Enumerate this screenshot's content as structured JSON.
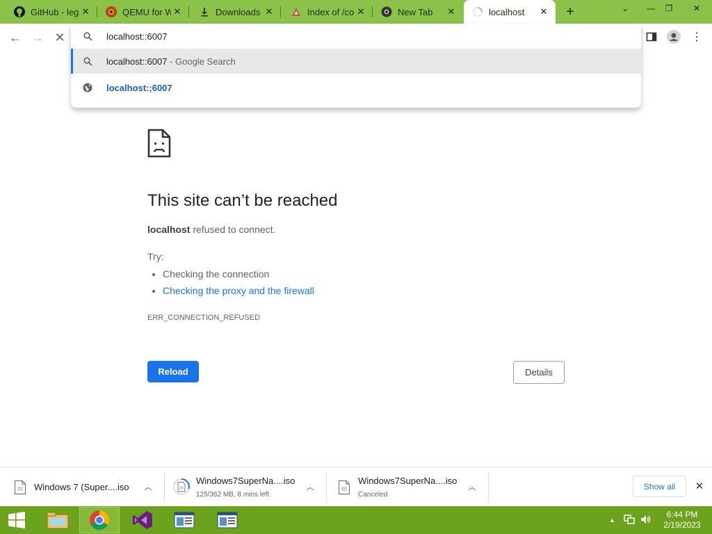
{
  "tabs": [
    {
      "title": "GitHub - leg",
      "icon": "github-icon"
    },
    {
      "title": "QEMU for W",
      "icon": "qemu-icon"
    },
    {
      "title": "Downloads",
      "icon": "download-icon"
    },
    {
      "title": "Index of /co",
      "icon": "index-icon"
    },
    {
      "title": "New Tab",
      "icon": "chrome-icon"
    },
    {
      "title": "localhost",
      "icon": "loading-spinner-icon",
      "active": true
    }
  ],
  "omnibox": {
    "value": "localhost::6007",
    "suggestions": [
      {
        "primary": "localhost::6007",
        "secondary": " - Google Search",
        "icon": "search-icon"
      },
      {
        "primary": "localhost:;6007",
        "secondary": "",
        "icon": "globe-icon"
      }
    ]
  },
  "error": {
    "title": "This site can’t be reached",
    "host": "localhost",
    "message": " refused to connect.",
    "try_label": "Try:",
    "suggestions": [
      "Checking the connection",
      "Checking the proxy and the firewall"
    ],
    "code": "ERR_CONNECTION_REFUSED",
    "reload_label": "Reload",
    "details_label": "Details"
  },
  "downloads": {
    "items": [
      {
        "name": "Windows 7 (Super....iso",
        "status": ""
      },
      {
        "name": "Windows7SuperNa....iso",
        "status": "125/362 MB, 8 mins left"
      },
      {
        "name": "Windows7SuperNa....iso",
        "status": "Canceled"
      }
    ],
    "show_all_label": "Show all"
  },
  "taskbar": {
    "time": "6:44 PM",
    "date": "2/19/2023"
  },
  "colors": {
    "tab_strip": "#8bc34a",
    "taskbar": "#6da21f",
    "accent": "#1a73e8"
  }
}
